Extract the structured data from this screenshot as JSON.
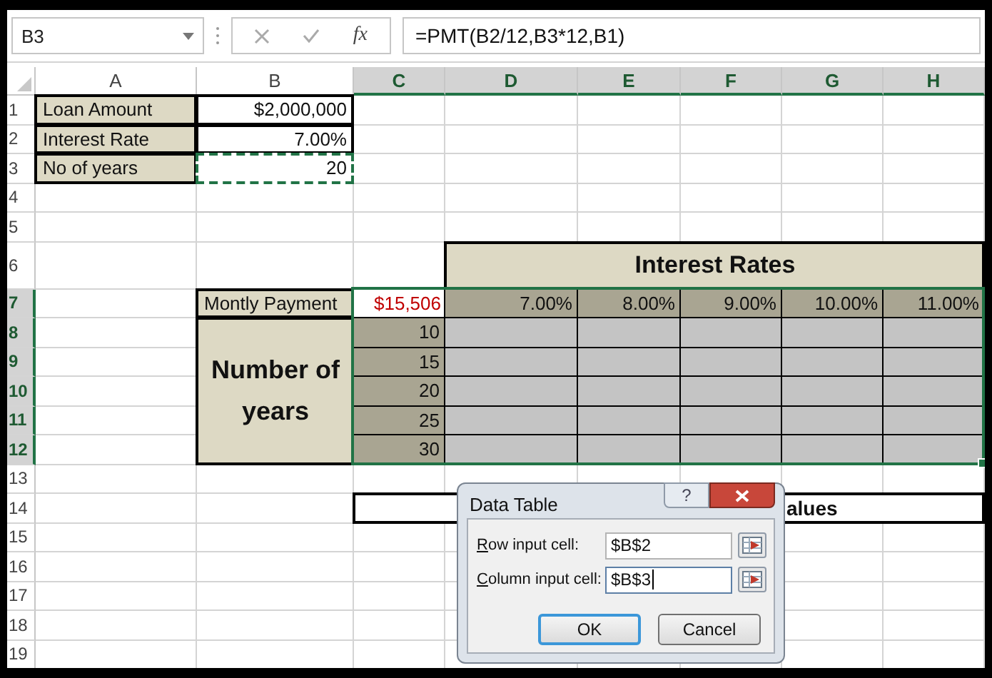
{
  "formula_bar": {
    "name_box": "B3",
    "function_label": "fx",
    "formula": "=PMT(B2/12,B3*12,B1)"
  },
  "columns": [
    {
      "label": "A",
      "selected": false
    },
    {
      "label": "B",
      "selected": false
    },
    {
      "label": "C",
      "selected": true
    },
    {
      "label": "D",
      "selected": true
    },
    {
      "label": "E",
      "selected": true
    },
    {
      "label": "F",
      "selected": true
    },
    {
      "label": "G",
      "selected": true
    },
    {
      "label": "H",
      "selected": true
    }
  ],
  "rows": [
    {
      "label": "1",
      "selected": false
    },
    {
      "label": "2",
      "selected": false
    },
    {
      "label": "3",
      "selected": false
    },
    {
      "label": "4",
      "selected": false
    },
    {
      "label": "5",
      "selected": false
    },
    {
      "label": "6",
      "selected": false
    },
    {
      "label": "7",
      "selected": true
    },
    {
      "label": "8",
      "selected": true
    },
    {
      "label": "9",
      "selected": true
    },
    {
      "label": "10",
      "selected": true
    },
    {
      "label": "11",
      "selected": true
    },
    {
      "label": "12",
      "selected": true
    },
    {
      "label": "13",
      "selected": false
    },
    {
      "label": "14",
      "selected": false
    },
    {
      "label": "15",
      "selected": false
    },
    {
      "label": "16",
      "selected": false
    },
    {
      "label": "17",
      "selected": false
    },
    {
      "label": "18",
      "selected": false
    },
    {
      "label": "19",
      "selected": false
    }
  ],
  "inputs": [
    {
      "label": "Loan Amount",
      "value": "$2,000,000",
      "copied": false
    },
    {
      "label": "Interest Rate",
      "value": "7.00%",
      "copied": false
    },
    {
      "label": "No of years",
      "value": "20",
      "copied": true
    }
  ],
  "data_table": {
    "title": "Interest Rates",
    "row_label": "Montly Payment",
    "result": "$15,506",
    "rates": [
      "7.00%",
      "8.00%",
      "9.00%",
      "10.00%",
      "11.00%"
    ],
    "group_label": "Number of years",
    "terms": [
      "10",
      "15",
      "20",
      "25",
      "30"
    ]
  },
  "note_box": {
    "text": "alues"
  },
  "dialog": {
    "title": "Data Table",
    "help_label": "?",
    "fields": [
      {
        "label": "Row input cell:",
        "value": "$B$2",
        "focused": false
      },
      {
        "label": "Column input cell:",
        "value": "$B$3",
        "focused": true
      }
    ],
    "buttons": [
      {
        "label": "OK",
        "default": true
      },
      {
        "label": "Cancel",
        "default": false
      }
    ]
  }
}
